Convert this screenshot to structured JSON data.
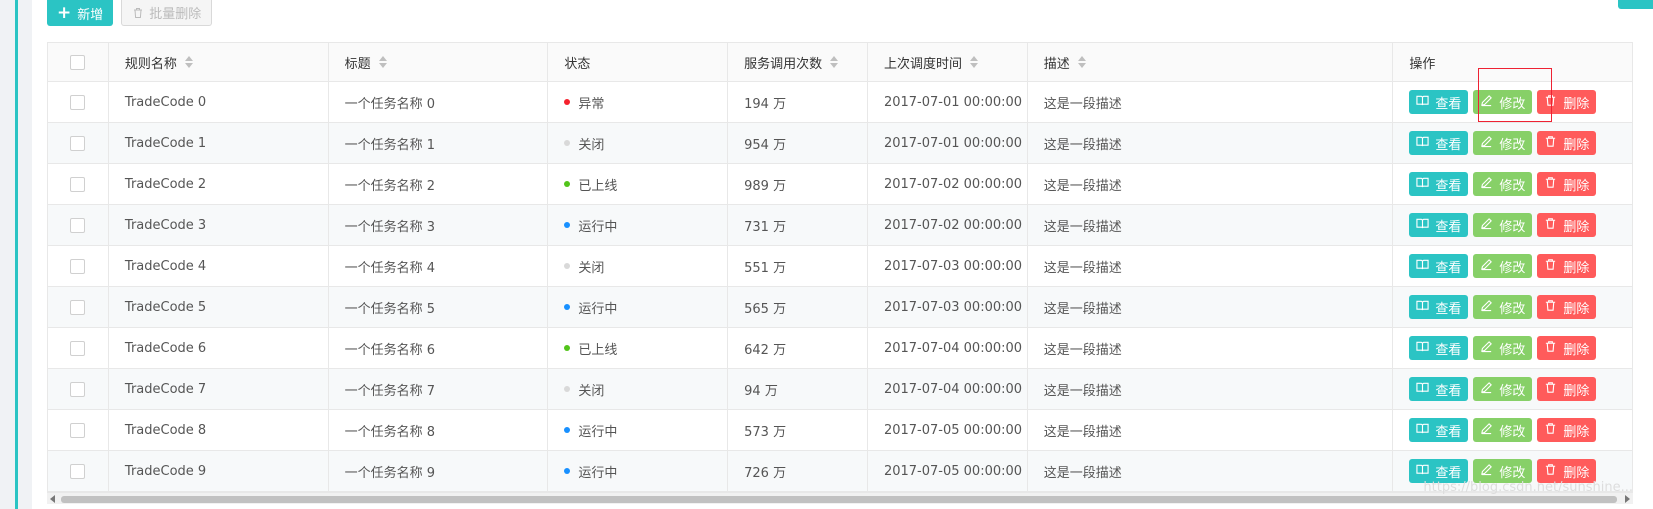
{
  "toolbar": {
    "add_label": "新增",
    "batch_delete_label": "批量删除"
  },
  "table": {
    "columns": [
      "规则名称",
      "标题",
      "状态",
      "服务调用次数",
      "上次调度时间",
      "描述",
      "操作"
    ],
    "actions": {
      "view": "查看",
      "edit": "修改",
      "delete": "删除"
    },
    "rows": [
      {
        "name": "TradeCode 0",
        "title": "一个任务名称 0",
        "status": "异常",
        "status_color": "#f5222d",
        "calls": "194 万",
        "time": "2017-07-01 00:00:00",
        "desc": "这是一段描述"
      },
      {
        "name": "TradeCode 1",
        "title": "一个任务名称 1",
        "status": "关闭",
        "status_color": "#d9d9d9",
        "calls": "954 万",
        "time": "2017-07-01 00:00:00",
        "desc": "这是一段描述"
      },
      {
        "name": "TradeCode 2",
        "title": "一个任务名称 2",
        "status": "已上线",
        "status_color": "#52c41a",
        "calls": "989 万",
        "time": "2017-07-02 00:00:00",
        "desc": "这是一段描述"
      },
      {
        "name": "TradeCode 3",
        "title": "一个任务名称 3",
        "status": "运行中",
        "status_color": "#1890ff",
        "calls": "731 万",
        "time": "2017-07-02 00:00:00",
        "desc": "这是一段描述"
      },
      {
        "name": "TradeCode 4",
        "title": "一个任务名称 4",
        "status": "关闭",
        "status_color": "#d9d9d9",
        "calls": "551 万",
        "time": "2017-07-03 00:00:00",
        "desc": "这是一段描述"
      },
      {
        "name": "TradeCode 5",
        "title": "一个任务名称 5",
        "status": "运行中",
        "status_color": "#1890ff",
        "calls": "565 万",
        "time": "2017-07-03 00:00:00",
        "desc": "这是一段描述"
      },
      {
        "name": "TradeCode 6",
        "title": "一个任务名称 6",
        "status": "已上线",
        "status_color": "#52c41a",
        "calls": "642 万",
        "time": "2017-07-04 00:00:00",
        "desc": "这是一段描述"
      },
      {
        "name": "TradeCode 7",
        "title": "一个任务名称 7",
        "status": "关闭",
        "status_color": "#d9d9d9",
        "calls": "94 万",
        "time": "2017-07-04 00:00:00",
        "desc": "这是一段描述"
      },
      {
        "name": "TradeCode 8",
        "title": "一个任务名称 8",
        "status": "运行中",
        "status_color": "#1890ff",
        "calls": "573 万",
        "time": "2017-07-05 00:00:00",
        "desc": "这是一段描述"
      },
      {
        "name": "TradeCode 9",
        "title": "一个任务名称 9",
        "status": "运行中",
        "status_color": "#1890ff",
        "calls": "726 万",
        "time": "2017-07-05 00:00:00",
        "desc": "这是一段描述"
      }
    ]
  },
  "watermark": "https://blog.csdn.net/sunshine..."
}
